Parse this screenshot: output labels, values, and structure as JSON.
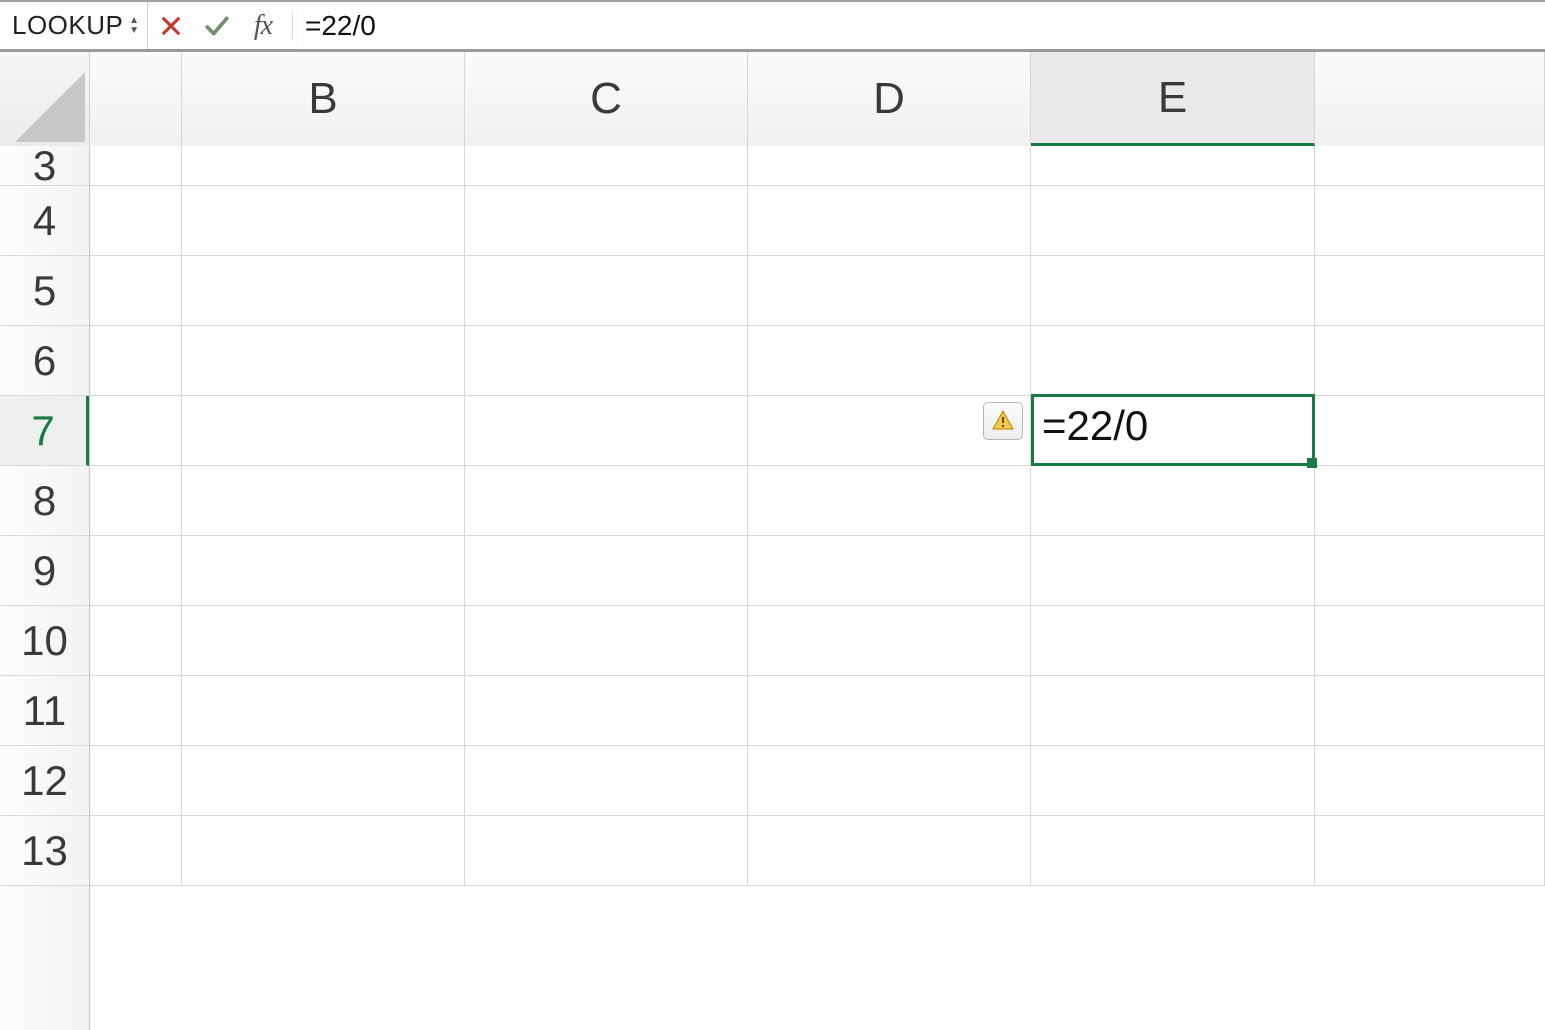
{
  "formula_bar": {
    "name_box": "LOOKUP",
    "fx_label": "fx",
    "formula_text": "=22/0"
  },
  "icons": {
    "cancel": "cancel-icon",
    "confirm": "confirm-icon",
    "fx": "fx-icon",
    "error": "error-warning-icon",
    "stepper": "stepper-icon"
  },
  "columns": {
    "A": "",
    "B": "B",
    "C": "C",
    "D": "D",
    "E": "E",
    "F": ""
  },
  "visible_rows": [
    "3",
    "4",
    "5",
    "6",
    "7",
    "8",
    "9",
    "10",
    "11",
    "12",
    "13"
  ],
  "row_labels": {
    "r3": "3",
    "r4": "4",
    "r5": "5",
    "r6": "6",
    "r7": "7",
    "r8": "8",
    "r9": "9",
    "r10": "10",
    "r11": "11",
    "r12": "12",
    "r13": "13"
  },
  "active_cell": {
    "address": "E7",
    "editing_text": "=22/0",
    "has_error_indicator": true
  }
}
